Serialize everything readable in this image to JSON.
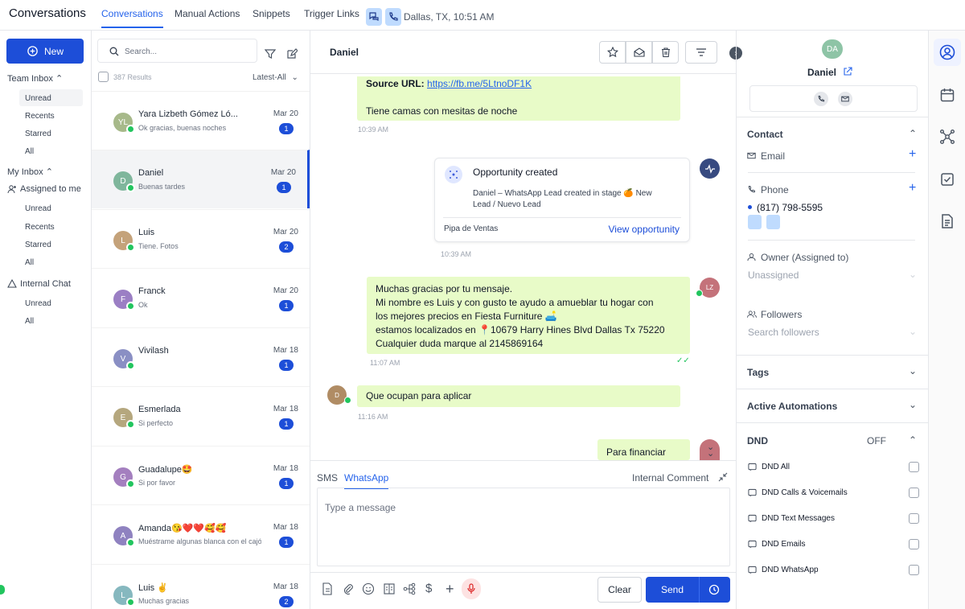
{
  "app": {
    "title": "Conversations"
  },
  "top_tabs": [
    {
      "label": "Conversations",
      "active": true
    },
    {
      "label": "Manual Actions"
    },
    {
      "label": "Snippets"
    },
    {
      "label": "Trigger Links"
    }
  ],
  "location_time": "Dallas, TX, 10:51 AM",
  "leftnav": {
    "new_label": "New",
    "team_inbox": "Team Inbox",
    "team_items": [
      "Unread",
      "Recents",
      "Starred",
      "All"
    ],
    "my_inbox": "My Inbox",
    "assigned": "Assigned to me",
    "my_items": [
      "Unread",
      "Recents",
      "Starred",
      "All"
    ],
    "internal_chat": "Internal Chat",
    "internal_items": [
      "Unread",
      "All"
    ]
  },
  "convlist": {
    "search_placeholder": "Search...",
    "results": "387 Results",
    "sort": "Latest-All",
    "items": [
      {
        "initials": "YL",
        "color": "#a7b98a",
        "name": "Yara Lizbeth Gómez Ló...",
        "preview": "Ok gracias, buenas noches",
        "date": "Mar 20",
        "count": "1"
      },
      {
        "initials": "D",
        "color": "#7fb69c",
        "name": "Daniel",
        "preview": "Buenas tardes",
        "date": "Mar 20",
        "count": "1"
      },
      {
        "initials": "L",
        "color": "#c4a27a",
        "name": "Luis",
        "preview": "Tiene. Fotos",
        "date": "Mar 20",
        "count": "2"
      },
      {
        "initials": "F",
        "color": "#9b7fc4",
        "name": "Franck",
        "preview": "Ok",
        "date": "Mar 20",
        "count": "1"
      },
      {
        "initials": "V",
        "color": "#8a8fc4",
        "name": "Vivilash",
        "preview": "",
        "date": "Mar 18",
        "count": "1"
      },
      {
        "initials": "E",
        "color": "#b5a77e",
        "name": "Esmerlada",
        "preview": "Si perfecto",
        "date": "Mar 18",
        "count": "1"
      },
      {
        "initials": "G",
        "color": "#a47fbf",
        "name": "Guadalupe🤩",
        "preview": "Si por favor",
        "date": "Mar 18",
        "count": "1"
      },
      {
        "initials": "A",
        "color": "#8f82c0",
        "name": "Amanda😘❤️❤️🥰🥰",
        "preview": "Muéstrame algunas blanca con el cajón",
        "date": "Mar 18",
        "count": "1"
      },
      {
        "initials": "L",
        "color": "#86b8bf",
        "name": "Luis ✌️",
        "preview": "Muchas gracias",
        "date": "Mar 18",
        "count": "2"
      }
    ]
  },
  "chat": {
    "contact_name": "Daniel",
    "msg1": {
      "source_label": "Source URL:",
      "link": "https://fb.me/5LtnoDF1K",
      "text": "Tiene camas con mesitas de noche",
      "time": "10:39 AM"
    },
    "opportunity": {
      "title": "Opportunity created",
      "body": "Daniel – WhatsApp Lead created in stage 🍊 New Lead / Nuevo Lead",
      "pipeline": "Pipa de Ventas",
      "link": "View opportunity",
      "time": "10:39 AM"
    },
    "msg2": {
      "lines": [
        "Muchas gracias por tu mensaje.",
        "Mi nombre es Luis y con gusto te ayudo a amueblar tu hogar con",
        "los mejores precios en Fiesta Furniture 🛋️",
        "estamos localizados en 📍10679 Harry Hines Blvd Dallas Tx 75220",
        "Cualquier duda marque al 2145869164"
      ],
      "time": "11:07 AM",
      "avatar": "LZ"
    },
    "msg3": {
      "text": "Que ocupan para aplicar",
      "time": "11:16 AM",
      "avatar": "D"
    },
    "msg4": {
      "text": "Para financiar"
    }
  },
  "composer": {
    "tabs": [
      "SMS",
      "WhatsApp"
    ],
    "active_tab": "WhatsApp",
    "internal_comment": "Internal Comment",
    "placeholder": "Type a message",
    "clear": "Clear",
    "send": "Send"
  },
  "contact_panel": {
    "initials": "DA",
    "name": "Daniel",
    "contact_title": "Contact",
    "email_label": "Email",
    "phone_label": "Phone",
    "phone_value": "(817) 798-5595",
    "owner_label": "Owner (Assigned to)",
    "owner_value": "Unassigned",
    "followers_label": "Followers",
    "followers_placeholder": "Search followers",
    "tags": "Tags",
    "automations": "Active Automations",
    "dnd": "DND",
    "dnd_status": "OFF",
    "dnd_items": [
      "DND All",
      "DND Calls & Voicemails",
      "DND Text Messages",
      "DND Emails",
      "DND WhatsApp"
    ]
  },
  "colors": {
    "accent": "#1d4ed8",
    "bubble": "#e8fbc8",
    "whatsapp": "#22c55e"
  }
}
